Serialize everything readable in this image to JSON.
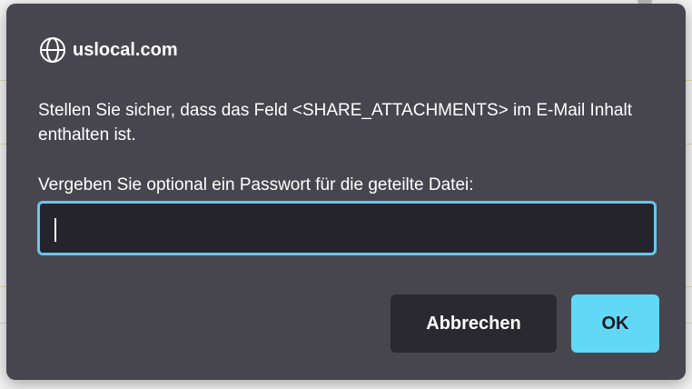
{
  "dialog": {
    "site": "uslocal.com",
    "message": "Stellen Sie sicher, dass das Feld <SHARE_ATTACHMENTS> im E-Mail Inhalt enthalten ist.",
    "prompt": "Vergeben Sie optional ein Passwort für die geteilte Datei:",
    "password_value": "",
    "cancel_label": "Abbrechen",
    "ok_label": "OK"
  },
  "colors": {
    "dialog_bg": "#47464f",
    "input_bg": "#25242c",
    "focus_ring": "#63c7ee",
    "ok_button": "#62d8f7",
    "cancel_button": "#2a2930"
  },
  "icons": {
    "site": "globe-icon"
  }
}
